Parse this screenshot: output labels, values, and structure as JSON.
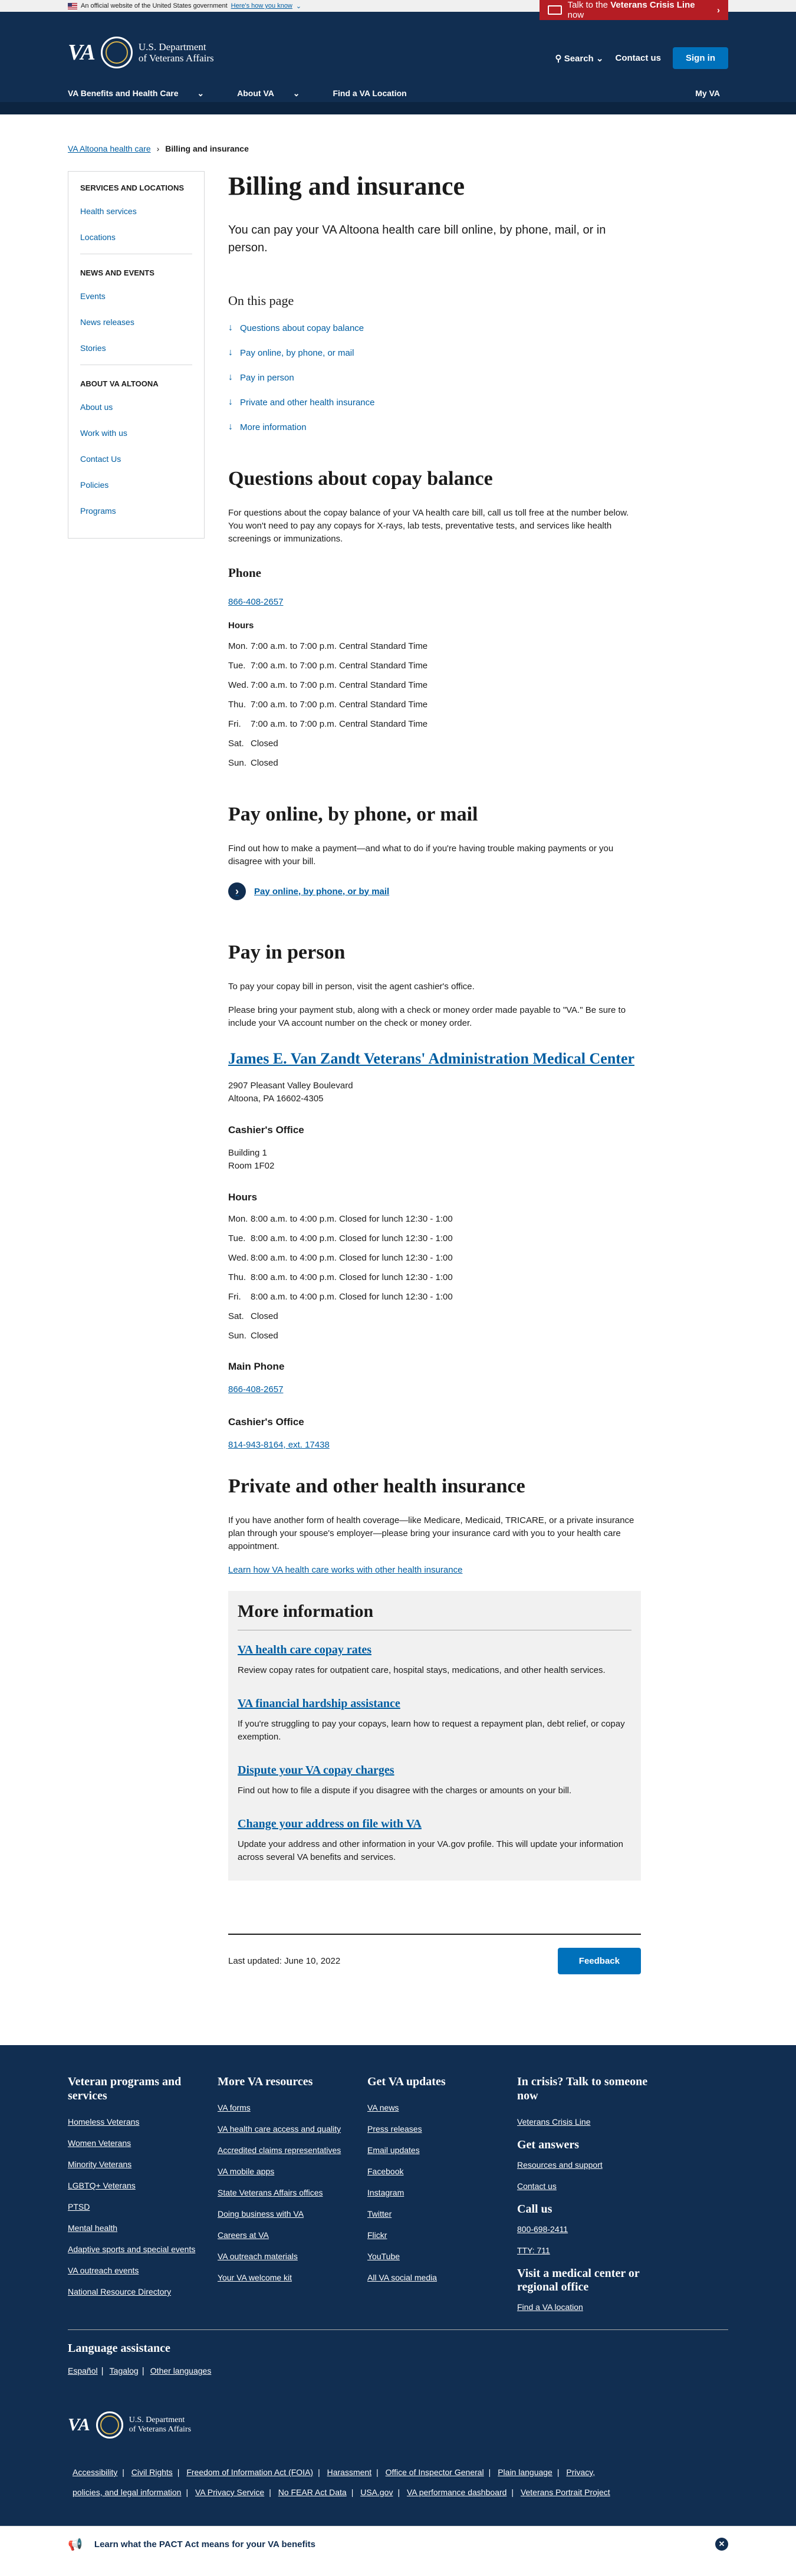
{
  "gov_banner": {
    "text": "An official website of the United States government",
    "link": "Here's how you know"
  },
  "crisis": {
    "prefix": "Talk to the",
    "bold": "Veterans Crisis Line",
    "suffix": "now"
  },
  "header": {
    "logo_text": "VA",
    "dept_line1": "U.S. Department",
    "dept_line2": "of Veterans Affairs",
    "search": "Search",
    "contact": "Contact us",
    "signin": "Sign in",
    "nav": [
      "VA Benefits and Health Care",
      "About VA",
      "Find a VA Location"
    ],
    "myva": "My VA"
  },
  "breadcrumb": {
    "parent": "VA Altoona health care",
    "current": "Billing and insurance"
  },
  "sidenav": {
    "sections": [
      {
        "title": "SERVICES AND LOCATIONS",
        "items": [
          "Health services",
          "Locations"
        ]
      },
      {
        "title": "NEWS AND EVENTS",
        "items": [
          "Events",
          "News releases",
          "Stories"
        ]
      },
      {
        "title": "ABOUT VA ALTOONA",
        "items": [
          "About us",
          "Work with us",
          "Contact Us",
          "Policies",
          "Programs"
        ]
      }
    ]
  },
  "page": {
    "title": "Billing and insurance",
    "lead": "You can pay your VA Altoona health care bill online, by phone, mail, or in person.",
    "otp_title": "On this page",
    "otp": [
      "Questions about copay balance",
      "Pay online, by phone, or mail",
      "Pay in person",
      "Private and other health insurance",
      "More information"
    ]
  },
  "copay": {
    "heading": "Questions about copay balance",
    "text": "For questions about the copay balance of your VA health care bill, call us toll free at the number below. You won't need to pay any copays for X-rays, lab tests, preventative tests, and services like health screenings or immunizations.",
    "phone_heading": "Phone",
    "phone": "866-408-2657",
    "hours_heading": "Hours",
    "hours": [
      {
        "day": "Mon.",
        "time": "7:00 a.m. to 7:00 p.m. Central Standard Time"
      },
      {
        "day": "Tue.",
        "time": "7:00 a.m. to 7:00 p.m. Central Standard Time"
      },
      {
        "day": "Wed.",
        "time": "7:00 a.m. to 7:00 p.m. Central Standard Time"
      },
      {
        "day": "Thu.",
        "time": "7:00 a.m. to 7:00 p.m. Central Standard Time"
      },
      {
        "day": "Fri.",
        "time": "7:00 a.m. to 7:00 p.m. Central Standard Time"
      },
      {
        "day": "Sat.",
        "time": "Closed"
      },
      {
        "day": "Sun.",
        "time": "Closed"
      }
    ]
  },
  "payonline": {
    "heading": "Pay online, by phone, or mail",
    "text": "Find out how to make a payment—and what to do if you're having trouble making payments or you disagree with your bill.",
    "link": "Pay online, by phone, or by mail"
  },
  "inperson": {
    "heading": "Pay in person",
    "text1": "To pay your copay bill in person, visit the agent cashier's office.",
    "text2": "Please bring your payment stub, along with a check or money order made payable to \"VA.\" Be sure to include your VA account number on the check or money order.",
    "facility": "James E. Van Zandt Veterans' Administration Medical Center",
    "address1": "2907 Pleasant Valley Boulevard",
    "address2": "Altoona, PA 16602-4305",
    "cashier_heading": "Cashier's Office",
    "building": "Building 1",
    "room": "Room 1F02",
    "hours_heading": "Hours",
    "hours": [
      {
        "day": "Mon.",
        "time": "8:00 a.m. to 4:00 p.m. Closed for lunch 12:30 - 1:00"
      },
      {
        "day": "Tue.",
        "time": "8:00 a.m. to 4:00 p.m. Closed for lunch 12:30 - 1:00"
      },
      {
        "day": "Wed.",
        "time": "8:00 a.m. to 4:00 p.m. Closed for lunch 12:30 - 1:00"
      },
      {
        "day": "Thu.",
        "time": "8:00 a.m. to 4:00 p.m. Closed for lunch 12:30 - 1:00"
      },
      {
        "day": "Fri.",
        "time": "8:00 a.m. to 4:00 p.m. Closed for lunch 12:30 - 1:00"
      },
      {
        "day": "Sat.",
        "time": "Closed"
      },
      {
        "day": "Sun.",
        "time": "Closed"
      }
    ],
    "main_phone_heading": "Main Phone",
    "main_phone": "866-408-2657",
    "cashier_phone_heading": "Cashier's Office",
    "cashier_phone": "814-943-8164, ext. 17438"
  },
  "private": {
    "heading": "Private and other health insurance",
    "text": "If you have another form of health coverage—like Medicare, Medicaid, TRICARE, or a private insurance plan through your spouse's employer—please bring your insurance card with you to your health care appointment.",
    "link": "Learn how VA health care works with other health insurance"
  },
  "more": {
    "heading": "More information",
    "items": [
      {
        "title": "VA health care copay rates",
        "text": "Review copay rates for outpatient care, hospital stays, medications, and other health services."
      },
      {
        "title": "VA financial hardship assistance",
        "text": "If you're struggling to pay your copays, learn how to request a repayment plan, debt relief, or copay exemption."
      },
      {
        "title": "Dispute your VA copay charges",
        "text": "Find out how to file a dispute if you disagree with the charges or amounts on your bill."
      },
      {
        "title": "Change your address on file with VA",
        "text": "Update your address and other information in your VA.gov profile. This will update your information across several VA benefits and services."
      }
    ]
  },
  "last_updated": "Last updated: June 10, 2022",
  "feedback": "Feedback",
  "footer": {
    "cols": [
      {
        "title": "Veteran programs and services",
        "links": [
          "Homeless Veterans",
          "Women Veterans",
          "Minority Veterans",
          "LGBTQ+ Veterans",
          "PTSD",
          "Mental health",
          "Adaptive sports and special events",
          "VA outreach events",
          "National Resource Directory"
        ]
      },
      {
        "title": "More VA resources",
        "links": [
          "VA forms",
          "VA health care access and quality",
          "Accredited claims representatives",
          "VA mobile apps",
          "State Veterans Affairs offices",
          "Doing business with VA",
          "Careers at VA",
          "VA outreach materials",
          "Your VA welcome kit"
        ]
      },
      {
        "title": "Get VA updates",
        "links": [
          "VA news",
          "Press releases",
          "Email updates",
          "Facebook",
          "Instagram",
          "Twitter",
          "Flickr",
          "YouTube",
          "All VA social media"
        ]
      }
    ],
    "crisis_title": "In crisis? Talk to someone now",
    "crisis_link": "Veterans Crisis Line",
    "answers_title": "Get answers",
    "answers_links": [
      "Resources and support",
      "Contact us"
    ],
    "call_title": "Call us",
    "call_links": [
      "800-698-2411",
      "TTY: 711"
    ],
    "visit_title": "Visit a medical center or regional office",
    "visit_link": "Find a VA location",
    "lang_title": "Language assistance",
    "langs": [
      "Español",
      "Tagalog",
      "Other languages"
    ],
    "bottom_links": [
      "Accessibility",
      "Civil Rights",
      "Freedom of Information Act (FOIA)",
      "Harassment",
      "Office of Inspector General",
      "Plain language",
      "Privacy, policies, and legal information",
      "VA Privacy Service",
      "No FEAR Act Data",
      "USA.gov",
      "VA performance dashboard",
      "Veterans Portrait Project"
    ]
  },
  "pact": {
    "text": "Learn what the PACT Act means for your VA benefits"
  }
}
